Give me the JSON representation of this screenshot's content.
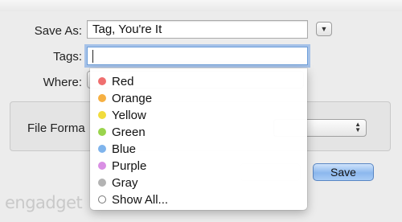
{
  "dialog": {
    "save_as_label": "Save As:",
    "save_as_value": "Tag, You're It",
    "tags_label": "Tags:",
    "tags_value": "",
    "where_label": "Where:",
    "file_format_label": "File Forma",
    "save_label": "Save"
  },
  "tag_menu": {
    "items": [
      {
        "label": "Red",
        "color": "#ef6f6f"
      },
      {
        "label": "Orange",
        "color": "#f6b042"
      },
      {
        "label": "Yellow",
        "color": "#f1dc3c"
      },
      {
        "label": "Green",
        "color": "#9ad44d"
      },
      {
        "label": "Blue",
        "color": "#7fb4ec"
      },
      {
        "label": "Purple",
        "color": "#d98fe4"
      },
      {
        "label": "Gray",
        "color": "#b3b3b3"
      },
      {
        "label": "Show All...",
        "color": "#ffffff"
      }
    ]
  },
  "watermark": "engadget"
}
